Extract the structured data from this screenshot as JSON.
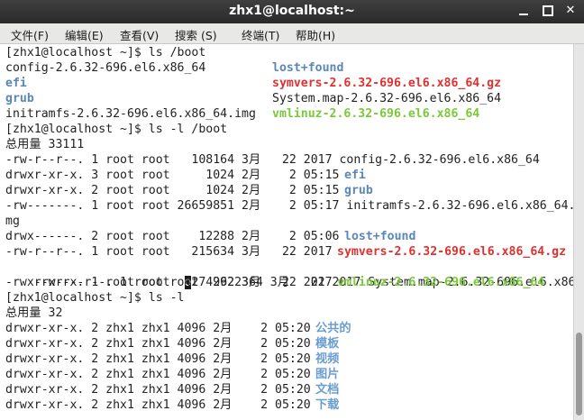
{
  "window": {
    "title": "zhx1@localhost:~",
    "controls": {
      "minimize": "",
      "maximize": "",
      "close": "✕"
    }
  },
  "menubar": [
    "文件(F)",
    "编辑(E)",
    "查看(V)",
    "搜索 (S)",
    "终端(T)",
    "帮助(H)"
  ],
  "colors": {
    "directory": "#5a87b8",
    "archive": "#e03030",
    "executable": "#79c93a",
    "symlink": "#6a9ed1"
  },
  "terminal": {
    "lines": [
      "[zhx1@localhost ~]$ ls /boot",
      "config-2.6.32-696.el6.x86_64",
      "efi",
      "grub",
      "initramfs-2.6.32-696.el6.x86_64.img",
      "[zhx1@localhost ~]$ ls -l /boot",
      "总用量 33111",
      "-rw-r--r--. 1 root root   108164 3月   22 2017 config-2.6.32-696.el6.x86_64",
      "drwxr-xr-x. 3 root root     1024 2月    2 05:15",
      "drwxr-xr-x. 2 root root     1024 2月    2 05:15",
      "-rw-------. 1 root root 26659851 2月    2 05:17 initramfs-2.6.32-696.el6.x86_64.i",
      "mg",
      "drwx------. 2 root root    12288 2月    2 05:06",
      "-rw-r--r--. 1 root root   215634 3月   22 2017",
      "-rw-r--r--. 1 root ro",
      "-rwxr-xr-x. 1 root root  4274992 3月   22 2017",
      "[zhx1@localhost ~]$ ls -l",
      "总用量 32",
      "drwxr-xr-x. 2 zhx1 zhx1 4096 2月    2 05:20",
      "drwxr-xr-x. 2 zhx1 zhx1 4096 2月    2 05:20",
      "drwxr-xr-x. 2 zhx1 zhx1 4096 2月    2 05:20",
      "drwxr-xr-x. 2 zhx1 zhx1 4096 2月    2 05:20",
      "drwxr-xr-x. 2 zhx1 zhx1 4096 2月    2 05:20",
      "drwxr-xr-x. 2 zhx1 zhx1 4096 2月    2 05:20"
    ],
    "col2": {
      "lost_found_1": "lost+found",
      "symvers_1": "symvers-2.6.32-696.el6.x86_64.gz",
      "system_map_1": "System.map-2.6.32-696.el6.x86_64",
      "vmlinuz_1": "vmlinuz-2.6.32-696.el6.x86_64"
    },
    "names": {
      "efi": "efi",
      "grub": "grub",
      "lost_found_2": "lost+found",
      "symvers_2": "symvers-2.6.32-696.el6.x86_64.gz",
      "cursor_char": "o",
      "rest_after_cursor": "t  2622364 3月   22 2017 System.map-2.6.32-696.el6.x86_64",
      "vmlinuz_2": "vmlinuz-2.6.32-696.el6.x86_64",
      "home_dirs": [
        "公共的",
        "模板",
        "视频",
        "图片",
        "文档",
        "下载"
      ]
    }
  }
}
